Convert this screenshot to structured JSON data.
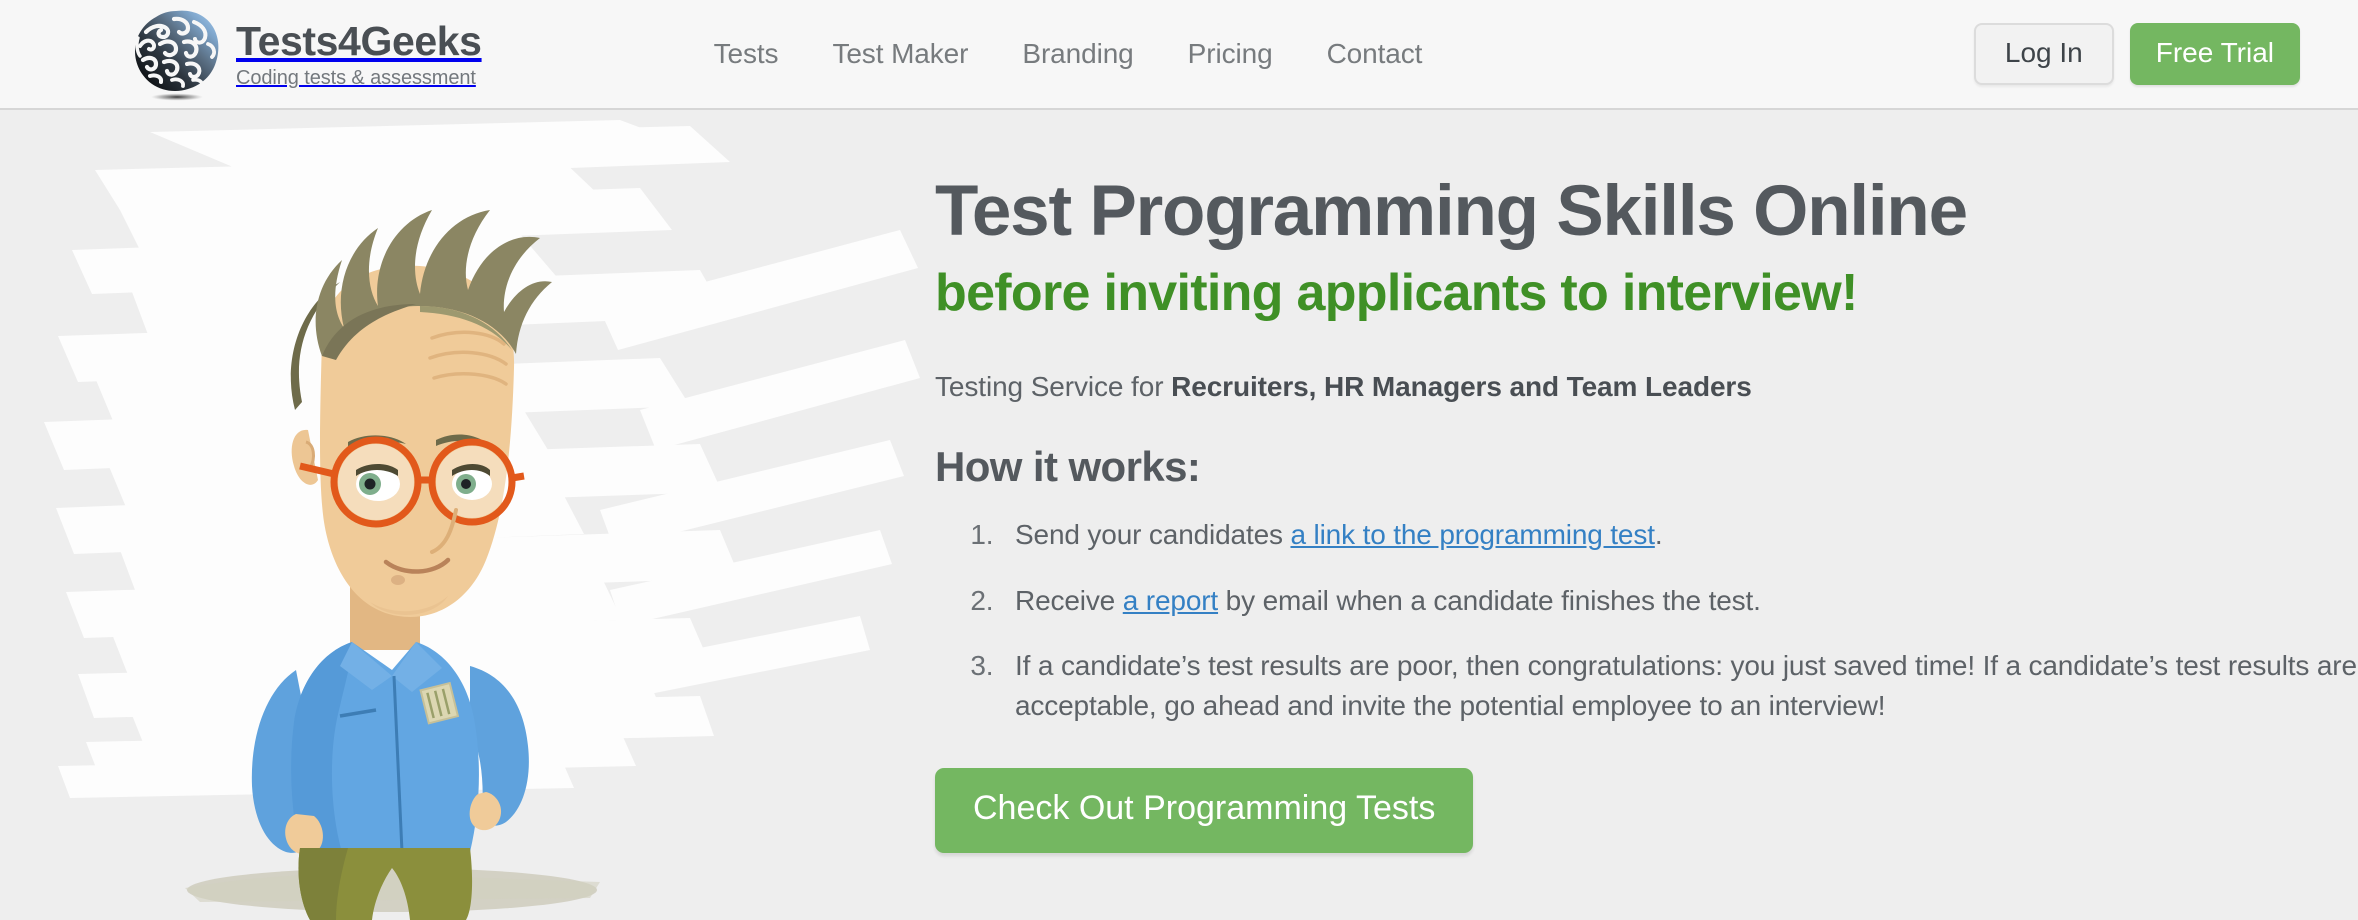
{
  "brand": {
    "title": "Tests4Geeks",
    "tagline": "Coding tests & assessment",
    "logo_icon": "brain-icon"
  },
  "nav": {
    "items": [
      {
        "label": "Tests"
      },
      {
        "label": "Test Maker"
      },
      {
        "label": "Branding"
      },
      {
        "label": "Pricing"
      },
      {
        "label": "Contact"
      }
    ]
  },
  "header_actions": {
    "login_label": "Log In",
    "trial_label": "Free Trial"
  },
  "hero": {
    "title": "Test Programming Skills Online",
    "subtitle": "before inviting applicants to interview!",
    "service_prefix": "Testing Service for ",
    "service_audience": "Recruiters, HR Managers and Team Leaders",
    "how_heading": "How it works:",
    "steps": [
      {
        "before_link": "Send your candidates ",
        "link": "a link to the programming test",
        "after_link": "."
      },
      {
        "before_link": "Receive ",
        "link": "a report",
        "after_link": " by email when a candidate finishes the test."
      },
      {
        "before_link": "If a candidate’s test results are poor, then congratulations: you just saved time! If a candidate’s test results are acceptable, go ahead and invite the potential employee to an interview!",
        "link": "",
        "after_link": ""
      }
    ],
    "cta_label": "Check Out Programming Tests",
    "illustration": "man-with-glasses-hands-on-hips-illustration"
  },
  "colors": {
    "brand_green": "#74b761",
    "subtitle_green": "#3f9026",
    "link_blue": "#3480c4",
    "heading_gray": "#54595e",
    "header_bg": "#f7f7f7",
    "hero_bg": "#eeeeee"
  }
}
